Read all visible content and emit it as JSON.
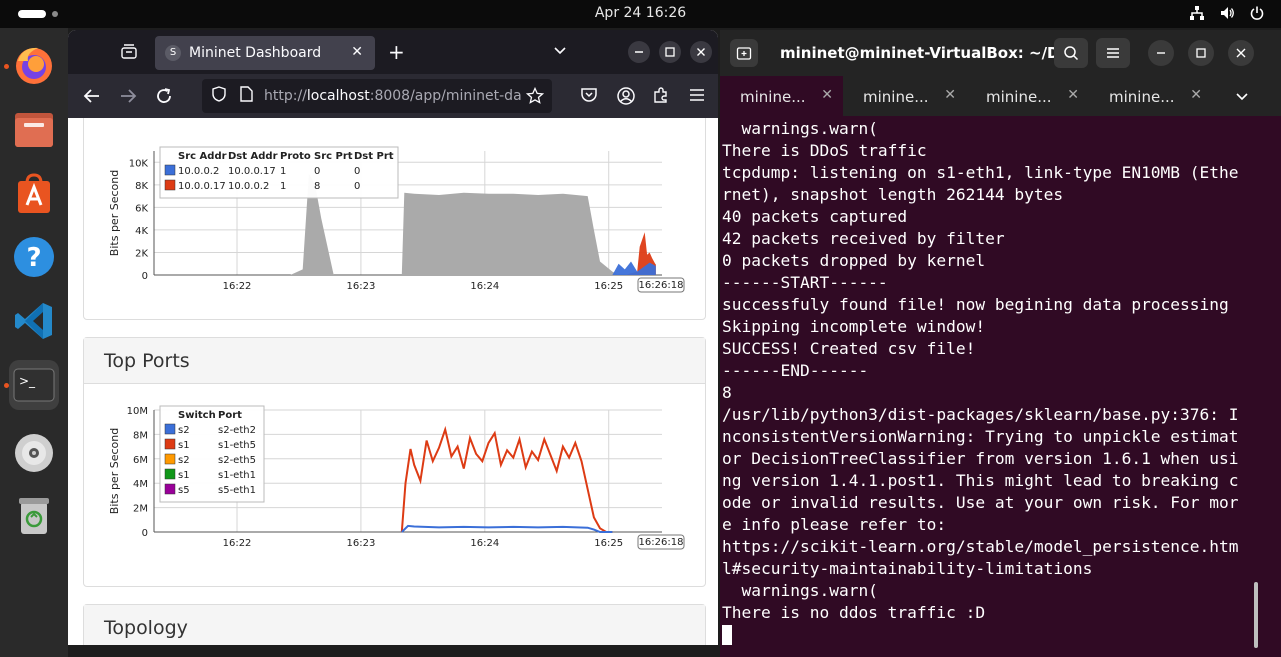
{
  "topbar": {
    "datetime": "Apr 24  16:26"
  },
  "browser": {
    "tab_title": "Mininet Dashboard",
    "url_prefix": "http://",
    "url_host": "localhost",
    "url_rest": ":8008/app/mininet-da"
  },
  "traffic_card": {
    "legend_headers": [
      "Src Addr",
      "Dst Addr",
      "Proto",
      "Src Prt",
      "Dst Prt"
    ],
    "legend_rows": [
      {
        "color": "#3b6fd8",
        "cells": [
          "10.0.0.2",
          "10.0.0.17",
          "1",
          "0",
          "0"
        ]
      },
      {
        "color": "#dd3b14",
        "cells": [
          "10.0.0.17",
          "10.0.0.2",
          "1",
          "8",
          "0"
        ]
      }
    ]
  },
  "ports_card": {
    "title": "Top Ports",
    "legend_headers": [
      "Switch",
      "Port"
    ],
    "legend_rows": [
      {
        "color": "#3b6fd8",
        "cells": [
          "s2",
          "s2-eth2"
        ]
      },
      {
        "color": "#dd3b14",
        "cells": [
          "s1",
          "s1-eth5"
        ]
      },
      {
        "color": "#ff9900",
        "cells": [
          "s2",
          "s2-eth5"
        ]
      },
      {
        "color": "#109618",
        "cells": [
          "s1",
          "s1-eth1"
        ]
      },
      {
        "color": "#990099",
        "cells": [
          "s5",
          "s5-eth1"
        ]
      }
    ]
  },
  "topology_card": {
    "title": "Topology"
  },
  "chart_data": [
    {
      "type": "area",
      "ylabel": "Bits per Second",
      "yticks": [
        "0",
        "2K",
        "4K",
        "6K",
        "8K",
        "10K"
      ],
      "ylim": [
        0,
        11000
      ],
      "xticks": [
        "16:22",
        "16:23",
        "16:24",
        "16:25",
        "16:2"
      ],
      "time_marker": "16:26:18",
      "grid": true,
      "legend_position": "top-left",
      "series": [
        {
          "color": "#aaaaaa",
          "x": [
            0,
            1.1,
            1.2,
            1.25,
            1.3,
            1.35,
            1.45,
            1.95,
            2.0,
            2.02,
            2.1,
            2.3,
            2.5,
            2.7,
            2.9,
            3.1,
            3.3,
            3.5,
            3.55,
            3.6,
            3.7,
            3.75,
            3.9,
            4.05
          ],
          "y": [
            0,
            0,
            500,
            9000,
            8000,
            5000,
            0,
            0,
            0,
            7300,
            7200,
            7100,
            7300,
            7200,
            7200,
            7100,
            7200,
            7000,
            4000,
            1200,
            300,
            0,
            0,
            1000
          ]
        },
        {
          "color": "#dd3b14",
          "x": [
            3.8,
            3.9,
            3.92,
            3.96,
            3.98,
            4.0,
            4.02,
            4.05
          ],
          "y": [
            0,
            300,
            2500,
            3800,
            1800,
            2000,
            1500,
            900
          ]
        },
        {
          "color": "#3b6fd8",
          "x": [
            3.7,
            3.75,
            3.8,
            3.85,
            3.9,
            3.95,
            4.0,
            4.05
          ],
          "y": [
            0,
            1000,
            500,
            1200,
            300,
            700,
            1100,
            800
          ]
        }
      ]
    },
    {
      "type": "line",
      "ylabel": "Bits per Second",
      "yticks": [
        "0",
        "2M",
        "4M",
        "6M",
        "8M",
        "10M"
      ],
      "ylim": [
        0,
        10000000
      ],
      "xticks": [
        "16:22",
        "16:23",
        "16:24",
        "16:25",
        "16:2"
      ],
      "time_marker": "16:26:18",
      "grid": true,
      "legend_position": "top-left",
      "series": [
        {
          "color": "#dd3b14",
          "x": [
            2.0,
            2.03,
            2.07,
            2.1,
            2.15,
            2.2,
            2.25,
            2.3,
            2.35,
            2.4,
            2.45,
            2.5,
            2.55,
            2.6,
            2.65,
            2.7,
            2.75,
            2.8,
            2.85,
            2.9,
            2.95,
            3.0,
            3.05,
            3.1,
            3.15,
            3.2,
            3.25,
            3.3,
            3.35,
            3.4,
            3.45,
            3.5,
            3.55,
            3.6,
            3.65,
            3.7
          ],
          "y": [
            0,
            4000000,
            6800000,
            5500000,
            4200000,
            7500000,
            5800000,
            6900000,
            8400000,
            6200000,
            7000000,
            5200000,
            7700000,
            6400000,
            5800000,
            7300000,
            8100000,
            5500000,
            6700000,
            6100000,
            7600000,
            5300000,
            6600000,
            5900000,
            7600000,
            6300000,
            5000000,
            7000000,
            6100000,
            7300000,
            5800000,
            3500000,
            1200000,
            300000,
            0,
            0
          ]
        },
        {
          "color": "#3b6fd8",
          "x": [
            2.0,
            2.05,
            2.1,
            2.3,
            2.5,
            2.7,
            2.9,
            3.1,
            3.3,
            3.5,
            3.55,
            3.6,
            3.7
          ],
          "y": [
            0,
            500000,
            450000,
            380000,
            420000,
            380000,
            420000,
            380000,
            420000,
            350000,
            200000,
            0,
            0
          ]
        }
      ]
    }
  ],
  "terminal": {
    "title": "mininet@mininet-VirtualBox: ~/Do...",
    "tabs": [
      "minine...",
      "minine...",
      "minine...",
      "minine..."
    ],
    "lines": [
      "  warnings.warn(",
      "There is DDoS traffic",
      "tcpdump: listening on s1-eth1, link-type EN10MB (Ethe",
      "rnet), snapshot length 262144 bytes",
      "40 packets captured",
      "42 packets received by filter",
      "0 packets dropped by kernel",
      "------START------",
      "successfuly found file! now begining data processing",
      "Skipping incomplete window!",
      "SUCCESS! Created csv file!",
      "------END------",
      "8",
      "/usr/lib/python3/dist-packages/sklearn/base.py:376: I",
      "nconsistentVersionWarning: Trying to unpickle estimat",
      "or DecisionTreeClassifier from version 1.6.1 when usi",
      "ng version 1.4.1.post1. This might lead to breaking c",
      "ode or invalid results. Use at your own risk. For mor",
      "e info please refer to:",
      "https://scikit-learn.org/stable/model_persistence.htm",
      "l#security-maintainability-limitations",
      "  warnings.warn(",
      "There is no ddos traffic :D"
    ]
  }
}
